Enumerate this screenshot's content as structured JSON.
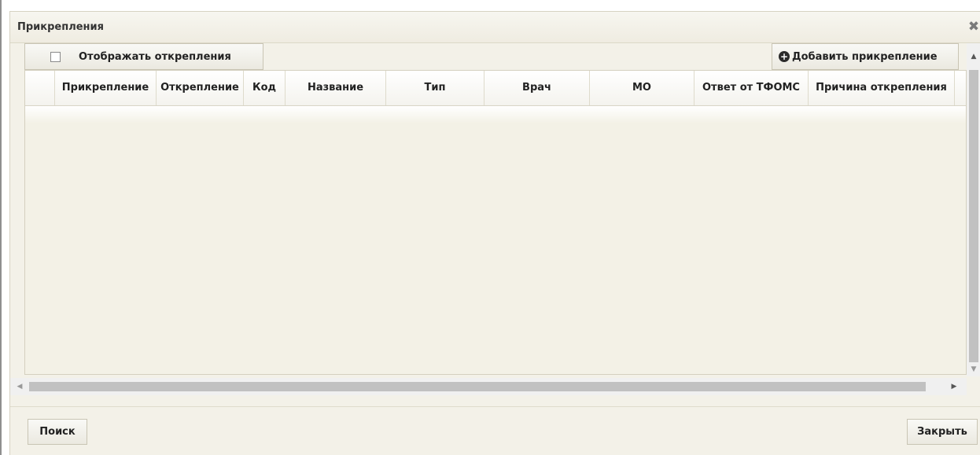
{
  "dialog": {
    "title": "Прикрепления",
    "close_symbol": "✖"
  },
  "toolbar": {
    "show_detachments_label": "Отображать открепления",
    "show_detachments_checked": false,
    "add_label": "Добавить прикрепление",
    "add_icon": "plus-circle-icon"
  },
  "grid": {
    "columns": [
      "",
      "Прикрепление",
      "Открепление",
      "Код",
      "Название",
      "Тип",
      "Врач",
      "МО",
      "Ответ от ТФОМС",
      "Причина открепления"
    ],
    "rows": []
  },
  "footer": {
    "search_label": "Поиск",
    "close_label": "Закрыть"
  },
  "colors": {
    "dialog_bg": "#f3f1e8",
    "grid_bg": "#f3f1e6",
    "scroll_thumb": "#c1c1c1"
  }
}
